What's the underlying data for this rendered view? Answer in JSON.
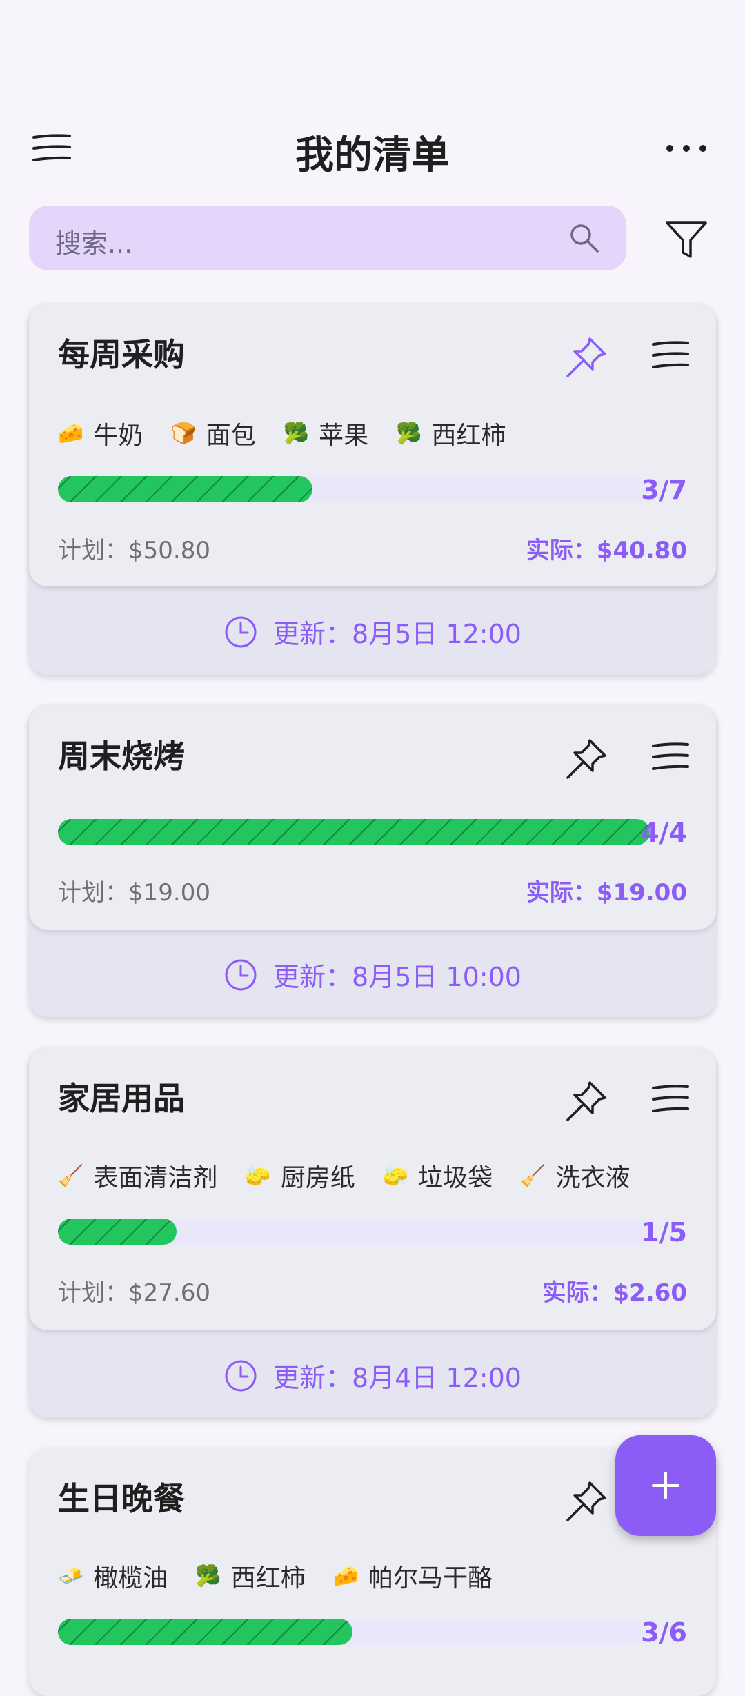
{
  "app": {
    "title": "我的清单"
  },
  "search": {
    "placeholder": "搜索..."
  },
  "colors": {
    "accent": "#8b5cf6",
    "progress": "#22c55e",
    "search_bg": "#e4d6fb"
  },
  "lists": [
    {
      "title": "每周采购",
      "pinned": true,
      "items": [
        {
          "emoji": "🧀",
          "name": "牛奶"
        },
        {
          "emoji": "🍞",
          "name": "面包"
        },
        {
          "emoji": "🥦",
          "name": "苹果"
        },
        {
          "emoji": "🥦",
          "name": "西红柿"
        }
      ],
      "progress": "3/7",
      "progress_fraction": 0.43,
      "planned": "计划：$50.80",
      "actual": "实际：$40.80",
      "updated": "更新：8月5日 12:00"
    },
    {
      "title": "周末烧烤",
      "pinned": false,
      "items": [],
      "progress": "4/4",
      "progress_fraction": 1.0,
      "planned": "计划：$19.00",
      "actual": "实际：$19.00",
      "updated": "更新：8月5日 10:00"
    },
    {
      "title": "家居用品",
      "pinned": false,
      "items": [
        {
          "emoji": "🧹",
          "name": "表面清洁剂"
        },
        {
          "emoji": "🧽",
          "name": "厨房纸"
        },
        {
          "emoji": "🧽",
          "name": "垃圾袋"
        },
        {
          "emoji": "🧹",
          "name": "洗衣液"
        }
      ],
      "progress": "1/5",
      "progress_fraction": 0.2,
      "planned": "计划：$27.60",
      "actual": "实际：$2.60",
      "updated": "更新：8月4日 12:00"
    },
    {
      "title": "生日晚餐",
      "pinned": false,
      "items": [
        {
          "emoji": "🧈",
          "name": "橄榄油"
        },
        {
          "emoji": "🥦",
          "name": "西红柿"
        },
        {
          "emoji": "🧀",
          "name": "帕尔马干酪"
        }
      ],
      "progress": "3/6",
      "progress_fraction": 0.5
    }
  ],
  "fab": {
    "label": "+"
  }
}
